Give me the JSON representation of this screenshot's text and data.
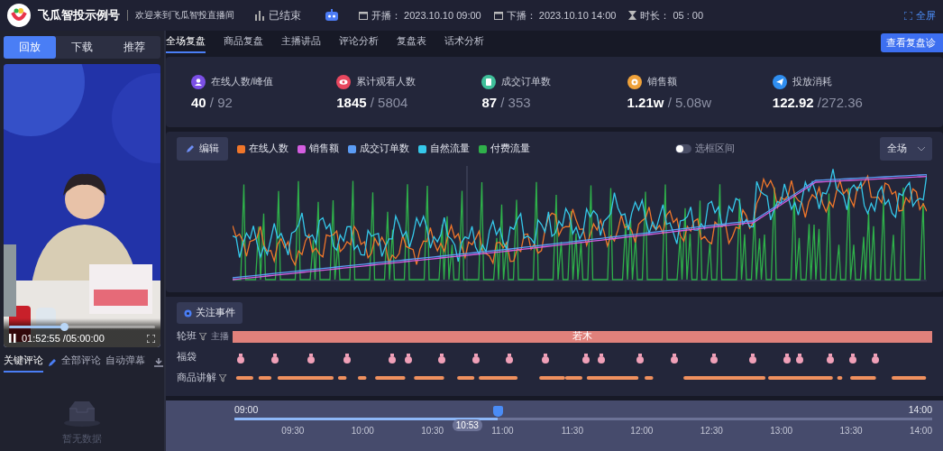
{
  "header": {
    "brand": "飞瓜智投示例号",
    "welcome": "欢迎来到飞瓜智投直播间",
    "status": "已结束",
    "start_label": "开播：",
    "start": "2023.10.10 09:00",
    "end_label": "下播：",
    "end": "2023.10.10 14:00",
    "duration_label": "时长：",
    "duration": "05 : 00",
    "fullscreen": "全屏"
  },
  "player_tabs": [
    {
      "label": "回放",
      "selected": true
    },
    {
      "label": "下载",
      "selected": false
    },
    {
      "label": "推荐",
      "selected": false
    }
  ],
  "video": {
    "kind": "picture",
    "level": 0.376,
    "time": "01:52:55 /05:00:00"
  },
  "comment_tabs": [
    {
      "label": "关键评论",
      "selected": true
    },
    {
      "label": "全部评论",
      "selected": false
    },
    {
      "label": "自动弹幕",
      "selected": false
    }
  ],
  "comments_empty": "暂无数据",
  "main_tabs": [
    {
      "label": "全场复盘",
      "selected": true
    },
    {
      "label": "商品复盘",
      "selected": false
    },
    {
      "label": "主播讲品",
      "selected": false
    },
    {
      "label": "评论分析",
      "selected": false
    },
    {
      "label": "复盘表",
      "selected": false
    },
    {
      "label": "话术分析",
      "selected": false
    }
  ],
  "diagnose_button": "查看复盘诊",
  "stats": [
    {
      "label": "在线人数/峰值",
      "value": "40",
      "total": "/ 92",
      "color": "#7b4fe6"
    },
    {
      "label": "累计观看人数",
      "value": "1845",
      "total": "/ 5804",
      "color": "#e8475f"
    },
    {
      "label": "成交订单数",
      "value": "87",
      "total": "/ 353",
      "color": "#3fbf9a"
    },
    {
      "label": "销售额",
      "value": "1.21w",
      "total": "/ 5.08w",
      "color": "#f0a23a"
    },
    {
      "label": "投放消耗",
      "value": "122.92",
      "total": "/272.36",
      "color": "#2f8ef0"
    }
  ],
  "chart": {
    "edit": "编辑",
    "legend": [
      {
        "label": "在线人数",
        "color": "#f0762a"
      },
      {
        "label": "销售额",
        "color": "#d45ee0"
      },
      {
        "label": "成交订单数",
        "color": "#5b9cf5"
      },
      {
        "label": "自然流量",
        "color": "#35c8ea"
      },
      {
        "label": "付费流量",
        "color": "#2fb04a"
      }
    ],
    "range_toggle": {
      "label": "选框区间",
      "on": false
    },
    "scope": "全场"
  },
  "events": {
    "button": "关注事件",
    "shift": {
      "label": "轮班",
      "sub": "主播",
      "anchor": "若木"
    },
    "lucky_bag": {
      "label": "福袋"
    },
    "product": {
      "label": "商品讲解"
    }
  },
  "timeline": {
    "start": "09:00",
    "end": "14:00",
    "level": 0.377,
    "current": "10:53",
    "ticks": [
      "09:30",
      "10:00",
      "10:30",
      "11:00",
      "11:30",
      "12:00",
      "12:30",
      "13:00",
      "13:30",
      "14:00"
    ]
  }
}
